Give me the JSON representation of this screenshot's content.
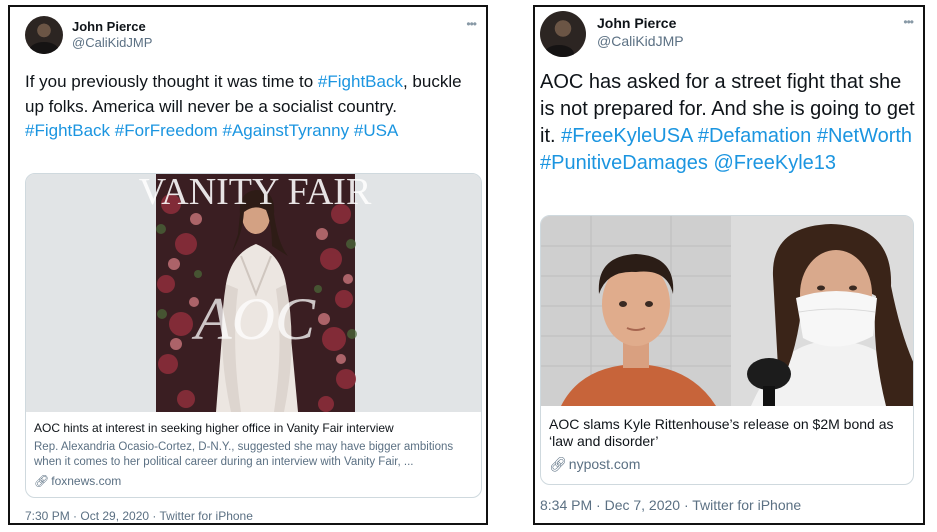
{
  "tweets": [
    {
      "author_name": "John Pierce",
      "author_handle": "@CaliKidJMP",
      "more_glyph": "•••",
      "body_parts": [
        {
          "text": "If you previously thought it was time to ",
          "tag": false
        },
        {
          "text": "#FightBack",
          "tag": true
        },
        {
          "text": ", buckle up folks. America will never be a socialist country. ",
          "tag": false
        },
        {
          "text": "#FightBack",
          "tag": true
        },
        {
          "text": " ",
          "tag": false
        },
        {
          "text": "#ForFreedom",
          "tag": true
        },
        {
          "text": " ",
          "tag": false
        },
        {
          "text": "#AgainstTyranny",
          "tag": true
        },
        {
          "text": " ",
          "tag": false
        },
        {
          "text": "#USA",
          "tag": true
        }
      ],
      "card": {
        "magazine_logo": "VANITY FAIR",
        "cover_text": "AOC",
        "title": "AOC hints at interest in seeking higher office in Vanity Fair interview",
        "description": "Rep. Alexandria Ocasio-Cortez, D-N.Y., suggested she may have bigger ambitions when it comes to her political career during an interview with Vanity Fair, ...",
        "link": "foxnews.com"
      },
      "meta": "7:30 PM · Oct 29, 2020 · Twitter for iPhone"
    },
    {
      "author_name": "John Pierce",
      "author_handle": "@CaliKidJMP",
      "more_glyph": "•••",
      "body_parts": [
        {
          "text": "AOC has asked for a street fight that she is not prepared for. And she is going to get it. ",
          "tag": false
        },
        {
          "text": "#FreeKyleUSA",
          "tag": true
        },
        {
          "text": " ",
          "tag": false
        },
        {
          "text": "#Defamation",
          "tag": true
        },
        {
          "text": " ",
          "tag": false
        },
        {
          "text": "#NetWorth",
          "tag": true
        },
        {
          "text": " ",
          "tag": false
        },
        {
          "text": "#PunitiveDamages",
          "tag": true
        },
        {
          "text": " ",
          "tag": false
        },
        {
          "text": "@FreeKyle13",
          "tag": true
        }
      ],
      "card": {
        "title": "AOC slams Kyle Rittenhouse’s release on $2M bond as ‘law and disorder’",
        "link": "nypost.com"
      },
      "meta": "8:34 PM · Dec 7, 2020 · Twitter for iPhone"
    }
  ],
  "colors": {
    "link": "#1b95e0",
    "secondary_text": "#5b7083",
    "card_border": "#cfd9de"
  },
  "icons": [
    "more-icon",
    "link-icon"
  ]
}
